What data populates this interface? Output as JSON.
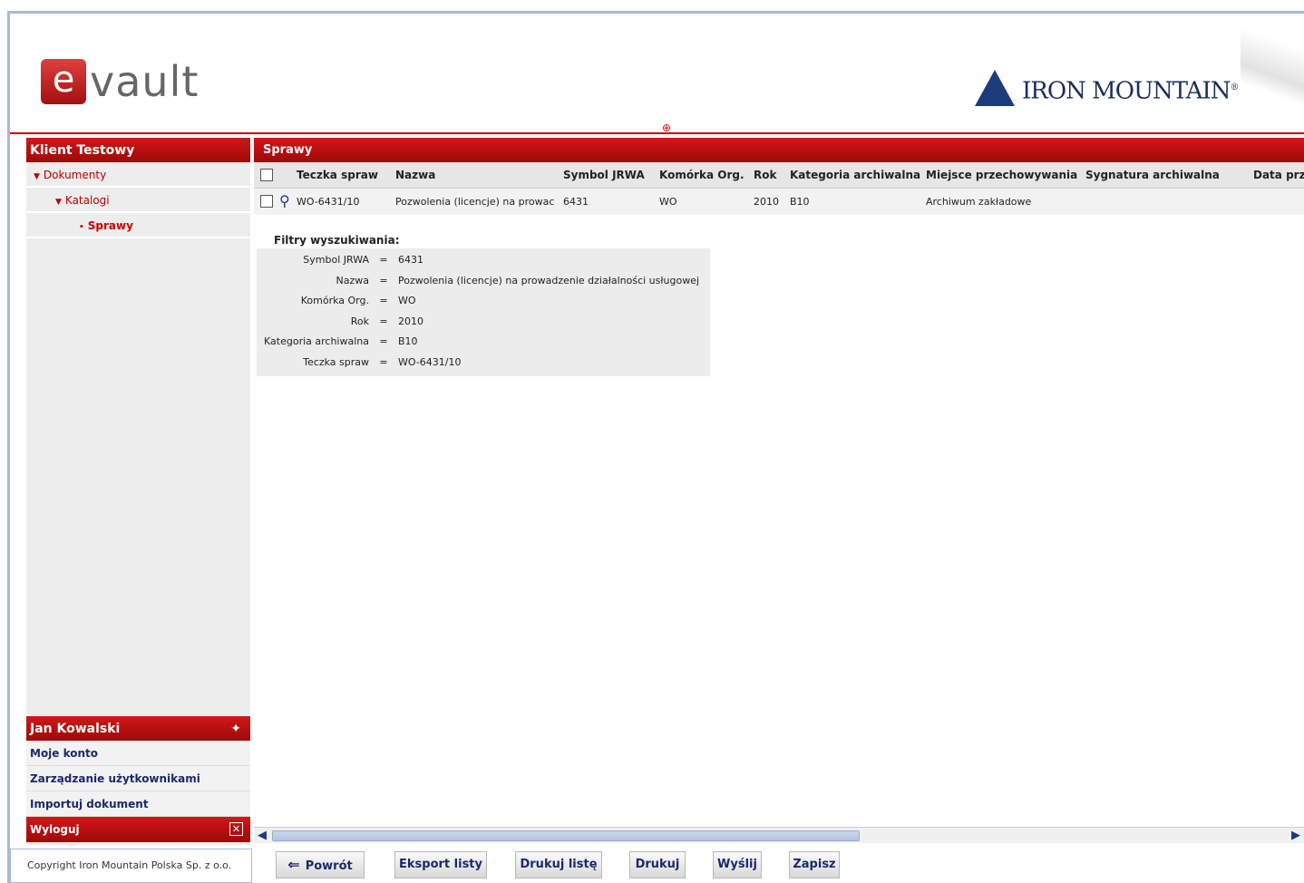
{
  "header": {
    "logo_e": "e",
    "logo_text": "vault",
    "brand": "IRON MOUNTAIN",
    "brand_mark": "®"
  },
  "sidebar": {
    "title": "Klient Testowy",
    "tree": [
      {
        "label": "Dokumenty"
      },
      {
        "label": "Katalogi"
      },
      {
        "label": "Sprawy"
      }
    ]
  },
  "user_panel": {
    "name": "Jan Kowalski",
    "links": [
      "Moje konto",
      "Zarządzanie użytkownikami",
      "Importuj dokument"
    ],
    "logout": "Wyloguj"
  },
  "copyright": "Copyright Iron Mountain Polska Sp. z o.o.",
  "main": {
    "title": "Sprawy",
    "columns": [
      "Teczka spraw",
      "Nazwa",
      "Symbol JRWA",
      "Komórka Org.",
      "Rok",
      "Kategoria archiwalna",
      "Miejsce przechowywania",
      "Sygnatura archiwalna",
      "Data prz"
    ],
    "rows": [
      {
        "teczka": "WO-6431/10",
        "nazwa": "Pozwolenia (licencje) na prowac",
        "symbol": "6431",
        "komorka": "WO",
        "rok": "2010",
        "kategoria": "B10",
        "miejsce": "Archiwum zakładowe",
        "sygnatura": "",
        "data": ""
      }
    ],
    "filters": {
      "title": "Filtry wyszukiwania:",
      "eq": "=",
      "items": [
        {
          "key": "Symbol JRWA",
          "value": "6431"
        },
        {
          "key": "Nazwa",
          "value": "Pozwolenia (licencje) na prowadzenie działalności usługowej"
        },
        {
          "key": "Komórka Org.",
          "value": "WO"
        },
        {
          "key": "Rok",
          "value": "2010"
        },
        {
          "key": "Kategoria archiwalna",
          "value": "B10"
        },
        {
          "key": "Teczka spraw",
          "value": "WO-6431/10"
        }
      ]
    }
  },
  "toolbar": {
    "back": "Powrót",
    "export": "Eksport listy",
    "print_list": "Drukuj listę",
    "print": "Drukuj",
    "send": "Wyślij",
    "save": "Zapisz"
  }
}
